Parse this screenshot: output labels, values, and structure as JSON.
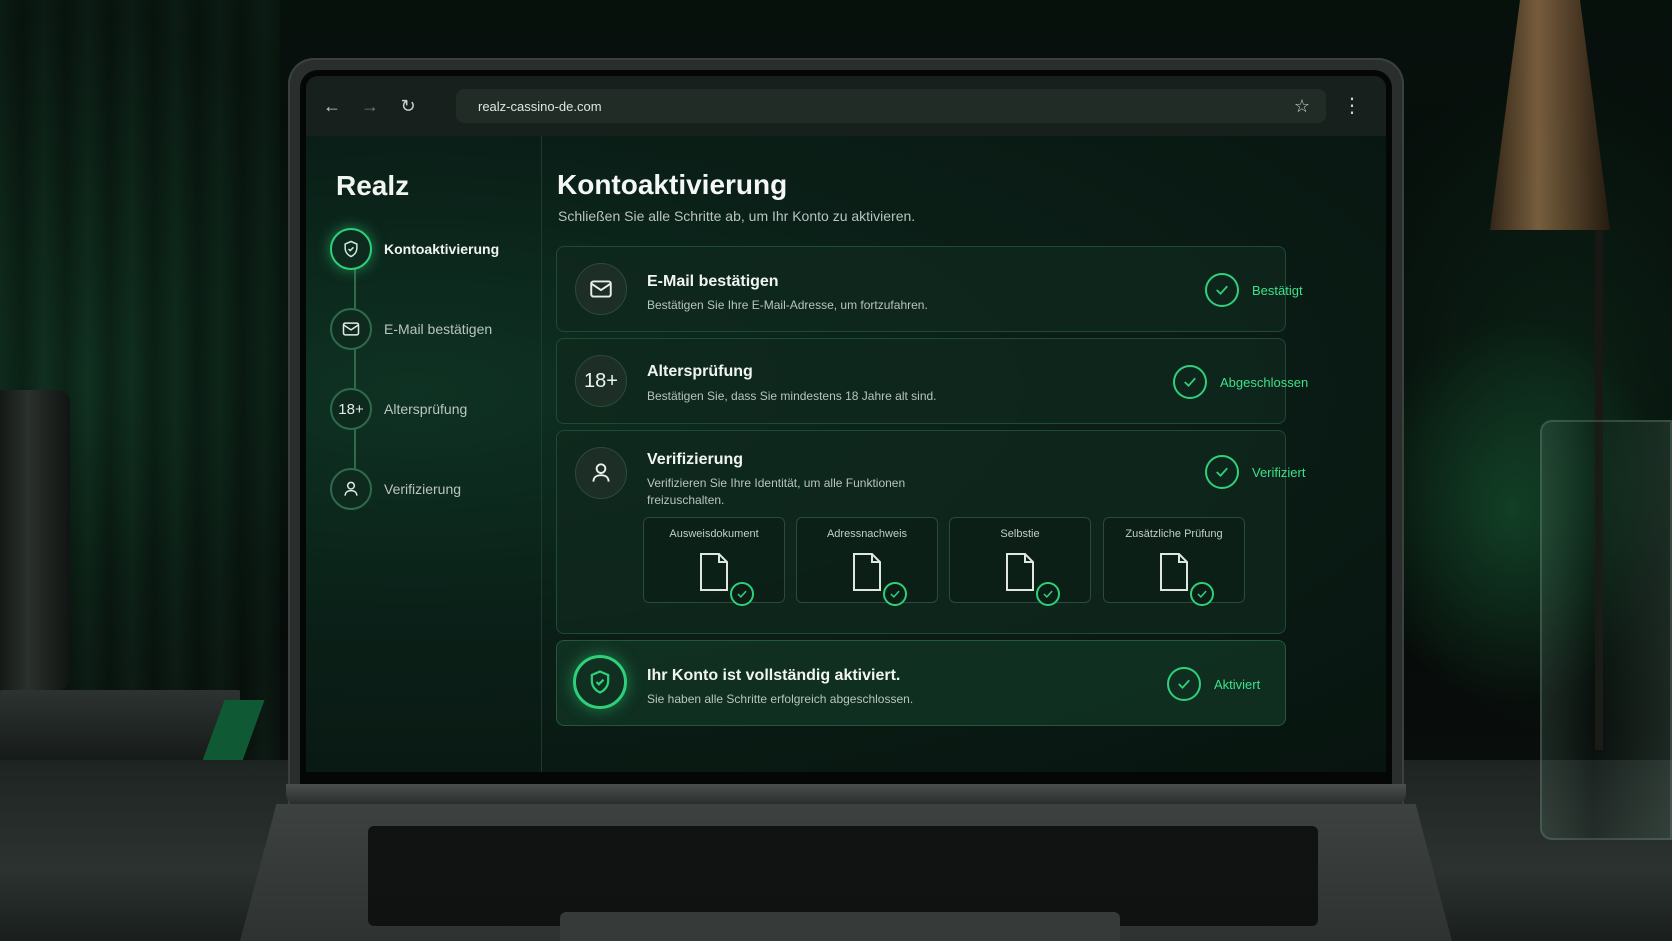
{
  "browser": {
    "url": "realz-cassino-de.com",
    "back_icon": "←",
    "forward_icon": "→",
    "reload_icon": "↻",
    "star_icon": "☆",
    "menu_icon": "⋮"
  },
  "sidebar": {
    "brand": "Realz",
    "steps": [
      {
        "label": "Kontoaktivierung",
        "icon": "shield-icon",
        "active": true
      },
      {
        "label": "E-Mail bestätigen",
        "icon": "mail-icon",
        "active": false
      },
      {
        "label": "Altersprüfung",
        "icon": "age-18-icon",
        "icon_text": "18+",
        "active": false
      },
      {
        "label": "Verifizierung",
        "icon": "user-icon",
        "active": false
      }
    ]
  },
  "main": {
    "title": "Kontoaktivierung",
    "subtitle": "Schließen Sie alle Schritte ab, um Ihr Konto zu aktivieren.",
    "cards": [
      {
        "title": "E-Mail bestätigen",
        "description": "Bestätigen Sie Ihre E-Mail-Adresse, um fortzufahren.",
        "status": "Bestätigt",
        "icon": "mail-icon"
      },
      {
        "title": "Altersprüfung",
        "description": "Bestätigen Sie, dass Sie mindestens 18 Jahre alt sind.",
        "status": "Abgeschlossen",
        "icon": "age-18-icon",
        "icon_text": "18+"
      },
      {
        "title": "Verifizierung",
        "description_line1": "Verifizieren Sie Ihre Identität, um alle Funktionen",
        "description_line2": "freizuschalten.",
        "status": "Verifiziert",
        "icon": "user-icon",
        "documents": [
          {
            "label": "Ausweisdokument"
          },
          {
            "label": "Adressnachweis"
          },
          {
            "label": "Selbstie"
          },
          {
            "label": "Zusätzliche Prüfung"
          }
        ]
      }
    ],
    "activated": {
      "title": "Ihr Konto ist vollständig aktiviert.",
      "description": "Sie haben alle Schritte erfolgreich abgeschlossen.",
      "status": "Aktiviert",
      "icon": "shield-icon"
    }
  },
  "colors": {
    "accent": "#2fd07a",
    "background": "#0a1410"
  }
}
